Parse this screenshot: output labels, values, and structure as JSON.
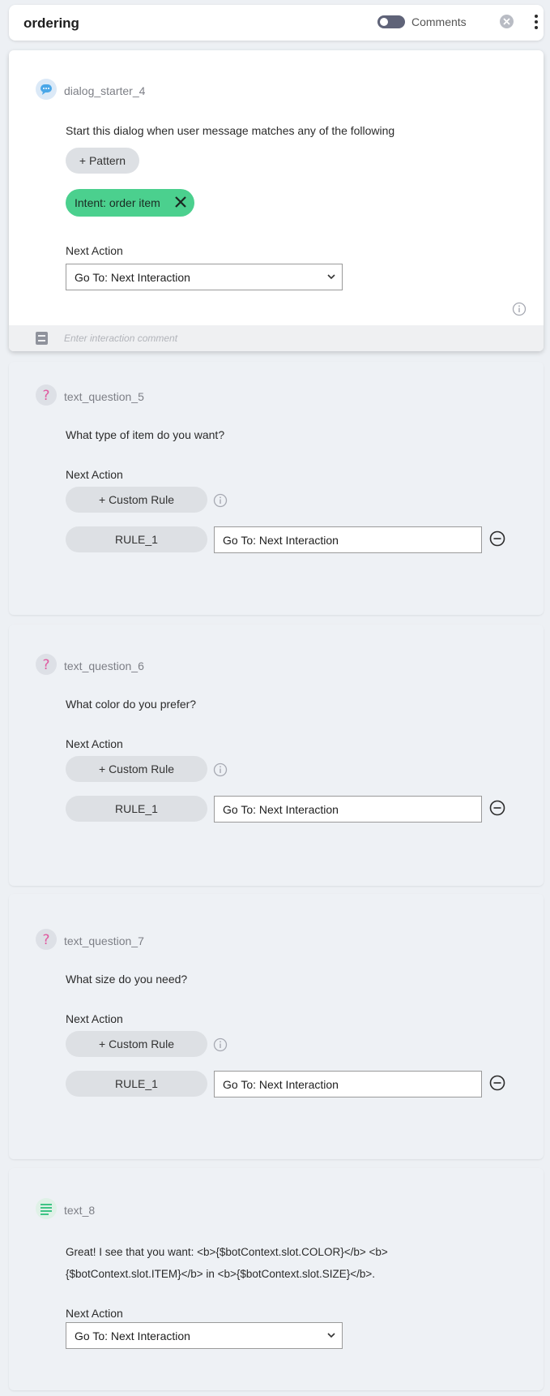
{
  "header": {
    "title": "ordering",
    "comments_label": "Comments"
  },
  "starter": {
    "name": "dialog_starter_4",
    "description": "Start this dialog when user message matches any of the following",
    "pattern_button": "+ Pattern",
    "intent_label": "Intent:",
    "intent_value": "order item",
    "next_action_label": "Next Action",
    "next_action_value": "Go To:  Next Interaction",
    "comment_placeholder": "Enter interaction comment"
  },
  "questions": [
    {
      "name": "text_question_5",
      "text": "What type of item do you want?",
      "next_action_label": "Next Action",
      "custom_rule": "+ Custom Rule",
      "rule_label": "RULE_1",
      "goto": "Go To:  Next Interaction"
    },
    {
      "name": "text_question_6",
      "text": "What color do you prefer?",
      "next_action_label": "Next Action",
      "custom_rule": "+ Custom Rule",
      "rule_label": "RULE_1",
      "goto": "Go To:  Next Interaction"
    },
    {
      "name": "text_question_7",
      "text": "What size do you need?",
      "next_action_label": "Next Action",
      "custom_rule": "+ Custom Rule",
      "rule_label": "RULE_1",
      "goto": "Go To:  Next Interaction"
    }
  ],
  "text_node": {
    "name": "text_8",
    "line1": "Great! I see that you want: <b>{$botContext.slot.COLOR}</b> <b>",
    "line2": "{$botContext.slot.ITEM}</b> in <b>{$botContext.slot.SIZE}</b>.",
    "next_action_label": "Next Action",
    "next_action_value": "Go To:  Next Interaction"
  },
  "icons": {
    "header": [
      "toggle-switch",
      "close-circle-icon",
      "more-vert-icon"
    ],
    "starter": "chat-bubble-icon",
    "question": "question-mark-icon",
    "text": "text-lines-icon",
    "comment": "note-icon",
    "info": "info-icon",
    "remove": "minus-circle-icon",
    "chevron": "chevron-down-icon"
  },
  "colors": {
    "intent_chip": "#4bd08e",
    "starter_icon": "#4aa7e8",
    "question_icon": "#e05aa0",
    "text_icon": "#3fc486",
    "page_bg": "#edf0f4"
  }
}
